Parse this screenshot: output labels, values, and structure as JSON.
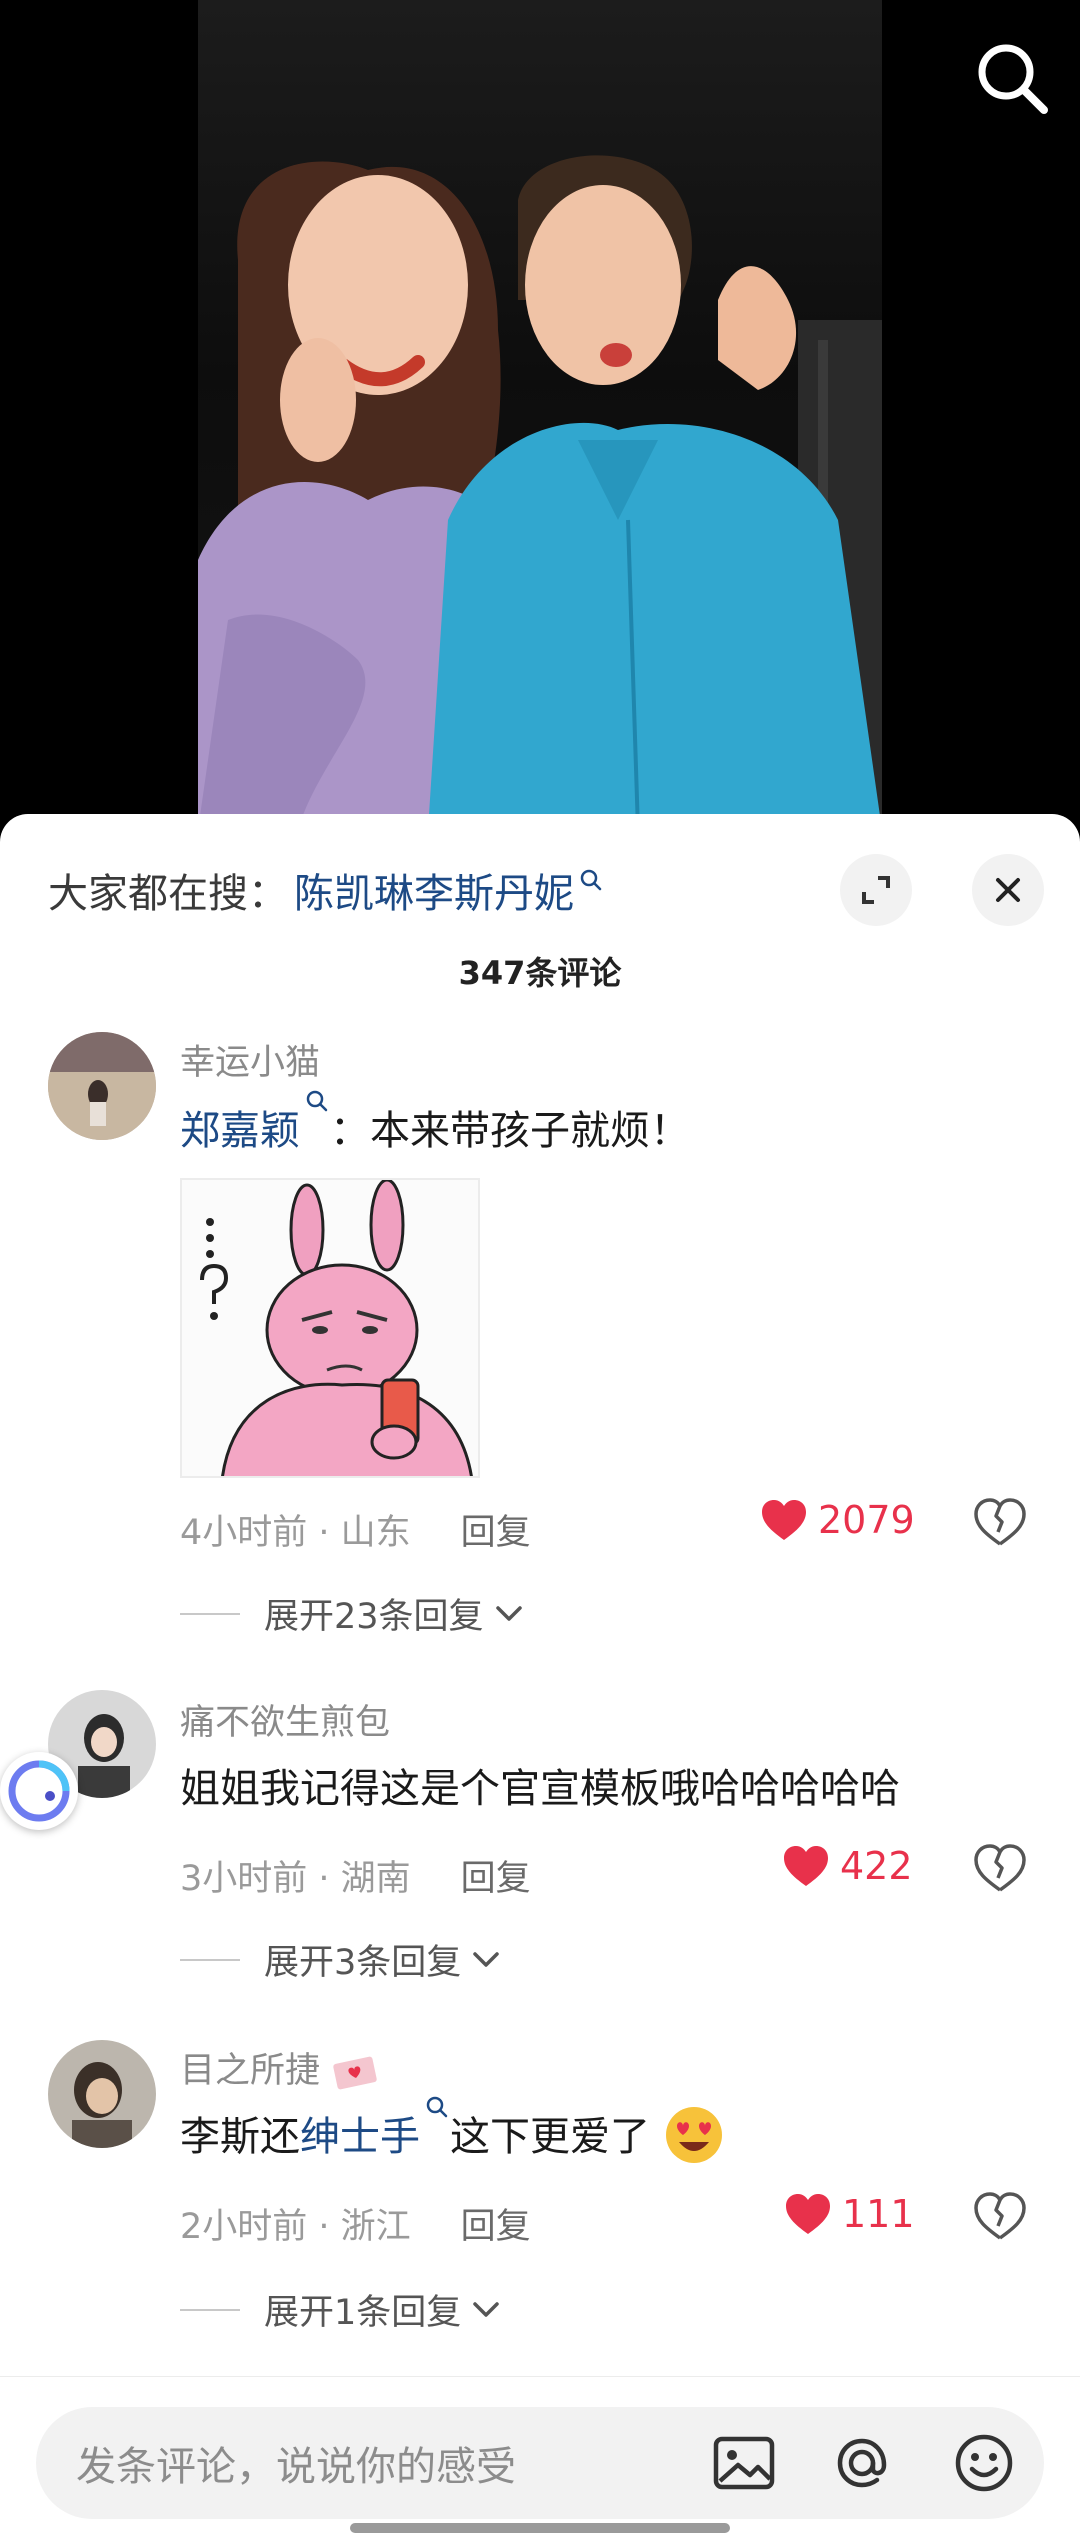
{
  "trending": {
    "label": "大家都在搜：",
    "query": "陈凯琳李斯丹妮"
  },
  "comment_count": "347条评论",
  "comments": [
    {
      "username": "幸运小猫",
      "mention": "郑嘉颖",
      "text": "：本来带孩子就烦！",
      "has_sticker": true,
      "time_location": "4小时前 · 山东",
      "reply_label": "回复",
      "likes": "2079",
      "expand_label": "展开23条回复"
    },
    {
      "username": "痛不欲生煎包",
      "text": "姐姐我记得这是个官宣模板哦哈哈哈哈哈",
      "time_location": "3小时前 · 湖南",
      "reply_label": "回复",
      "likes": "422",
      "expand_label": "展开3条回复"
    },
    {
      "username": "目之所捷",
      "text_before": "李斯还",
      "mention": "绅士手",
      "text_after": "这下更爱了",
      "time_location": "2小时前 · 浙江",
      "reply_label": "回复",
      "likes": "111",
      "expand_label": "展开1条回复"
    }
  ],
  "input": {
    "placeholder": "发条评论，说说你的感受"
  },
  "colors": {
    "link": "#1d4a85",
    "like": "#e8314b",
    "muted": "#9a9a9a"
  },
  "icons": [
    "search-icon",
    "expand-icon",
    "close-icon",
    "heart-icon",
    "broken-heart-icon",
    "chevron-down-icon",
    "image-icon",
    "at-icon",
    "emoji-icon",
    "heart-eyes-emoji",
    "love-letter-emoji"
  ]
}
